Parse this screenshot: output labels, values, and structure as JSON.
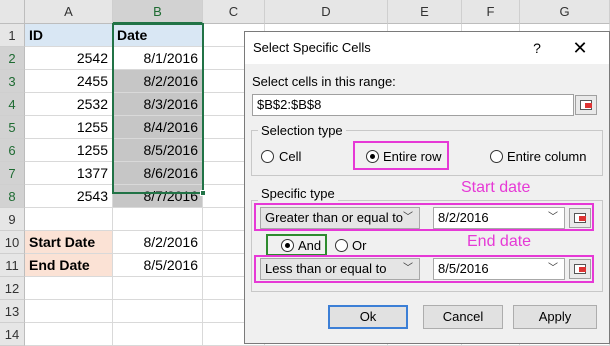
{
  "spreadsheet": {
    "columns": [
      "A",
      "B",
      "C",
      "D",
      "E",
      "F",
      "G"
    ],
    "rows": [
      "1",
      "2",
      "3",
      "4",
      "5",
      "6",
      "7",
      "8",
      "9",
      "10",
      "11",
      "12",
      "13",
      "14"
    ],
    "header": {
      "id": "ID",
      "date": "Date"
    },
    "data": [
      {
        "id": "2542",
        "date": "8/1/2016"
      },
      {
        "id": "2455",
        "date": "8/2/2016"
      },
      {
        "id": "2532",
        "date": "8/3/2016"
      },
      {
        "id": "1255",
        "date": "8/4/2016"
      },
      {
        "id": "1255",
        "date": "8/5/2016"
      },
      {
        "id": "1377",
        "date": "8/6/2016"
      },
      {
        "id": "2543",
        "date": "8/7/2016"
      }
    ],
    "start_date_label": "Start Date",
    "start_date_value": "8/2/2016",
    "end_date_label": "End Date",
    "end_date_value": "8/5/2016",
    "colors": {
      "selection": "#217346",
      "header_fill": "#d9e7f4",
      "label_fill": "#fbe2d5",
      "selected_fill": "#c6c6c6"
    }
  },
  "dialog": {
    "title": "Select Specific Cells",
    "help_label": "?",
    "close_label": "✕",
    "range_label": "Select cells in this range:",
    "range_value": "$B$2:$B$8",
    "selection_type": {
      "title": "Selection type",
      "options": [
        {
          "label": "Cell",
          "selected": false
        },
        {
          "label": "Entire row",
          "selected": true
        },
        {
          "label": "Entire column",
          "selected": false
        }
      ]
    },
    "specific_type": {
      "title": "Specific type",
      "condition1": {
        "operator": "Greater than or equal to",
        "value": "8/2/2016"
      },
      "logic": [
        {
          "label": "And",
          "selected": true
        },
        {
          "label": "Or",
          "selected": false
        }
      ],
      "condition2": {
        "operator": "Less than or equal to",
        "value": "8/5/2016"
      }
    },
    "buttons": {
      "ok": "Ok",
      "cancel": "Cancel",
      "apply": "Apply"
    },
    "annotations": {
      "start_note": "Start date",
      "end_note": "End date",
      "color": "#e639d6"
    }
  }
}
